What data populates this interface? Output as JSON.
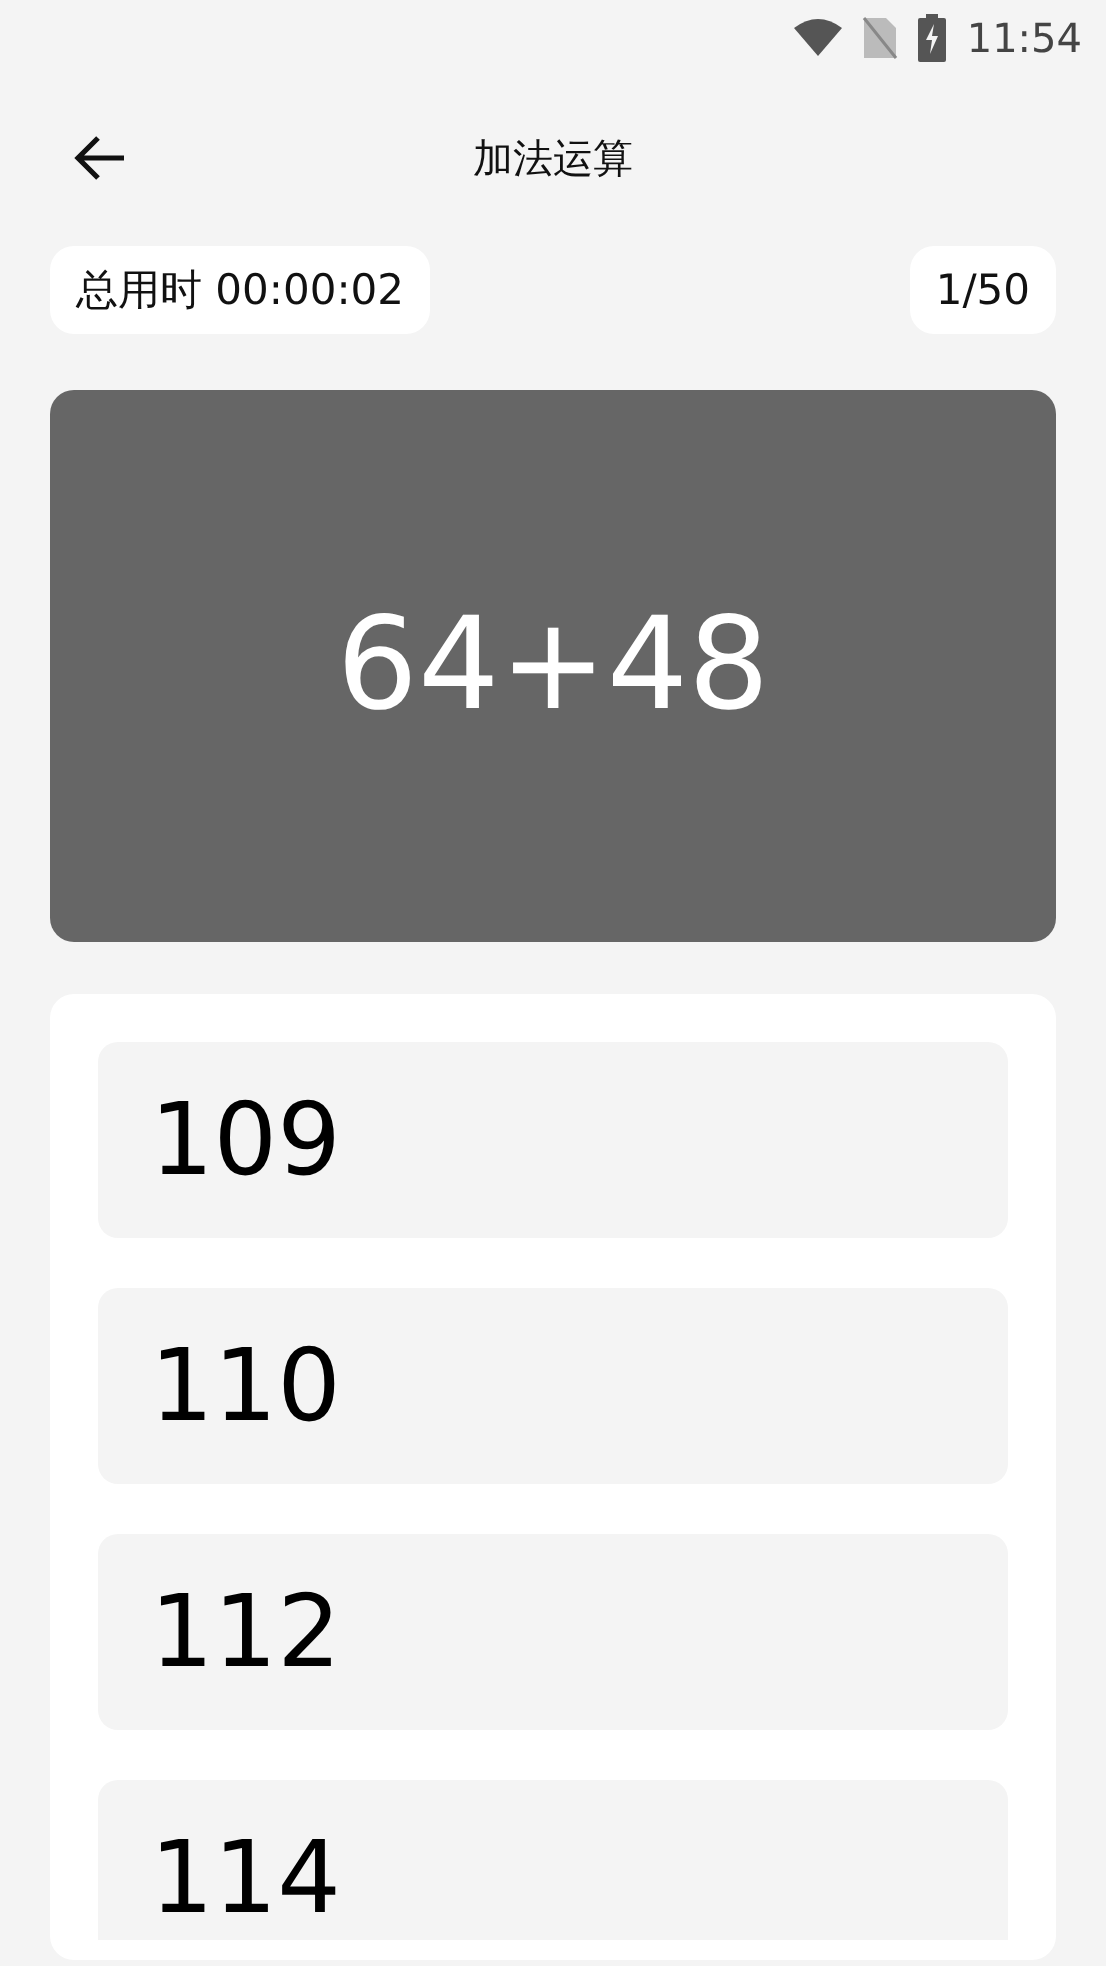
{
  "status_bar": {
    "time": "11:54"
  },
  "header": {
    "title": "加法运算"
  },
  "timer": {
    "label": "总用时 00:00:02"
  },
  "progress": {
    "label": "1/50"
  },
  "question": {
    "text": "64+48"
  },
  "options": [
    {
      "label": "109"
    },
    {
      "label": "110"
    },
    {
      "label": "112"
    },
    {
      "label": "114"
    }
  ]
}
